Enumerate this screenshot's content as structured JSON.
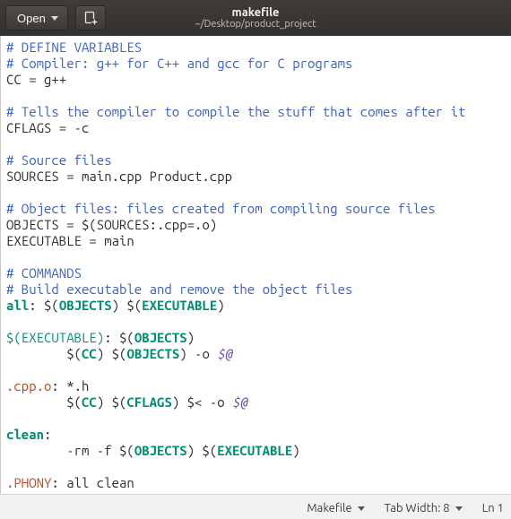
{
  "header": {
    "open_label": "Open",
    "title": "makefile",
    "subtitle": "~/Desktop/product_project"
  },
  "editor": {
    "lines": [
      {
        "t": "comment",
        "text": "# DEFINE VARIABLES"
      },
      {
        "t": "comment",
        "text": "# Compiler: g++ for C++ and gcc for C programs"
      },
      {
        "t": "plain",
        "text": "CC = g++"
      },
      {
        "t": "blank",
        "text": ""
      },
      {
        "t": "comment",
        "text": "# Tells the compiler to compile the stuff that comes after it"
      },
      {
        "t": "plain",
        "text": "CFLAGS = -c"
      },
      {
        "t": "blank",
        "text": ""
      },
      {
        "t": "comment",
        "text": "# Source files"
      },
      {
        "t": "plain",
        "text": "SOURCES = main.cpp Product.cpp"
      },
      {
        "t": "blank",
        "text": ""
      },
      {
        "t": "comment",
        "text": "# Object files: files created from compiling source files"
      },
      {
        "t": "plain",
        "text": "OBJECTS = $(SOURCES:.cpp=.o)"
      },
      {
        "t": "plain",
        "text": "EXECUTABLE = main"
      },
      {
        "t": "blank",
        "text": ""
      },
      {
        "t": "comment",
        "text": "# COMMANDS"
      },
      {
        "t": "comment",
        "text": "# Build executable and remove the object files"
      },
      {
        "t": "tgt1",
        "target": "all",
        "seg1": ": $(",
        "v1": "OBJECTS",
        "seg2": ") $(",
        "v2": "EXECUTABLE",
        "seg3": ")"
      },
      {
        "t": "blank",
        "text": ""
      },
      {
        "t": "tgt2",
        "target": "$(EXECUTABLE)",
        "seg1": ": $(",
        "v1": "OBJECTS",
        "seg2": ")"
      },
      {
        "t": "cmd1",
        "indent": "        $(",
        "v1": "CC",
        "mid1": ") $(",
        "v2": "OBJECTS",
        "mid2": ") -o ",
        "av": "$@"
      },
      {
        "t": "blank",
        "text": ""
      },
      {
        "t": "rule",
        "target": ".cpp.o",
        "rest": ": *.h"
      },
      {
        "t": "cmd2",
        "indent": "        $(",
        "v1": "CC",
        "mid1": ") $(",
        "v2": "CFLAGS",
        "mid2": ") $< -o ",
        "av": "$@"
      },
      {
        "t": "blank",
        "text": ""
      },
      {
        "t": "tgt0",
        "target": "clean",
        "rest": ":"
      },
      {
        "t": "cmd3",
        "indent": "        -rm -f $(",
        "v1": "OBJECTS",
        "mid1": ") $(",
        "v2": "EXECUTABLE",
        "mid2": ")"
      },
      {
        "t": "blank",
        "text": ""
      },
      {
        "t": "phony",
        "target": ".PHONY",
        "rest": ": all clean"
      }
    ]
  },
  "statusbar": {
    "filetype": "Makefile",
    "tabwidth_label": "Tab Width: 8",
    "position": "Ln 1"
  }
}
